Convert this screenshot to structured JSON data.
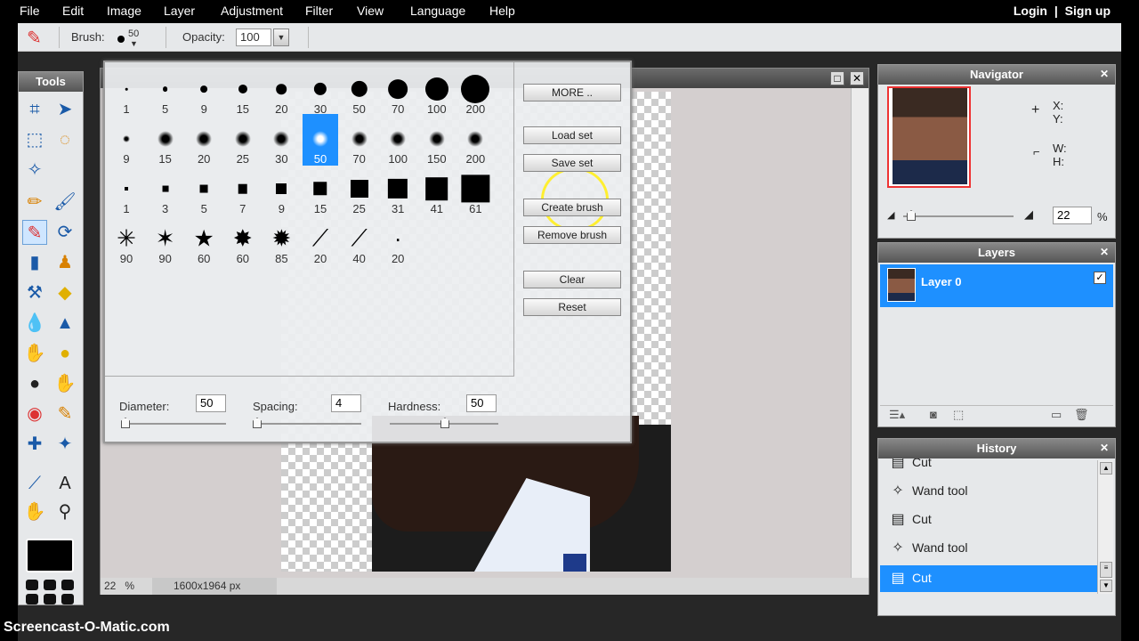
{
  "menu": [
    "File",
    "Edit",
    "Image",
    "Layer",
    "Adjustment",
    "Filter",
    "View",
    "Language",
    "Help"
  ],
  "auth": {
    "login": "Login",
    "sep": "|",
    "signup": "Sign up"
  },
  "options": {
    "brush_label": "Brush:",
    "brush_size": "50",
    "opacity_label": "Opacity:",
    "opacity_value": "100"
  },
  "tools": {
    "title": "Tools"
  },
  "brush_panel": {
    "rows": [
      [
        "1",
        "5",
        "9",
        "15",
        "20",
        "30",
        "50",
        "70",
        "100",
        "200"
      ],
      [
        "9",
        "15",
        "20",
        "25",
        "30",
        "50",
        "70",
        "100",
        "150",
        "200"
      ],
      [
        "1",
        "3",
        "5",
        "7",
        "9",
        "15",
        "25",
        "31",
        "41",
        "61"
      ],
      [
        "90",
        "90",
        "60",
        "60",
        "85",
        "20",
        "40",
        "20"
      ]
    ],
    "selected": "50",
    "buttons": {
      "more": "MORE ..",
      "load": "Load set",
      "save": "Save set",
      "create": "Create brush",
      "remove": "Remove brush",
      "clear": "Clear",
      "reset": "Reset"
    },
    "diameter_label": "Diameter:",
    "diameter": "50",
    "spacing_label": "Spacing:",
    "spacing": "4",
    "hardness_label": "Hardness:",
    "hardness": "50"
  },
  "status": {
    "zoom": "22",
    "zoom_unit": "%",
    "size": "1600x1964 px"
  },
  "navigator": {
    "title": "Navigator",
    "x": "X:",
    "y": "Y:",
    "w": "W:",
    "h": "H:",
    "zoom": "22",
    "unit": "%"
  },
  "layers": {
    "title": "Layers",
    "items": [
      {
        "name": "Layer 0"
      }
    ]
  },
  "history": {
    "title": "History",
    "items": [
      {
        "label": "Cut"
      },
      {
        "label": "Wand tool"
      },
      {
        "label": "Cut"
      },
      {
        "label": "Wand tool"
      },
      {
        "label": "Cut"
      }
    ]
  },
  "watermark": "Screencast-O-Matic.com",
  "colors": {
    "accent": "#1e90ff",
    "highlight": "#ffef30"
  }
}
